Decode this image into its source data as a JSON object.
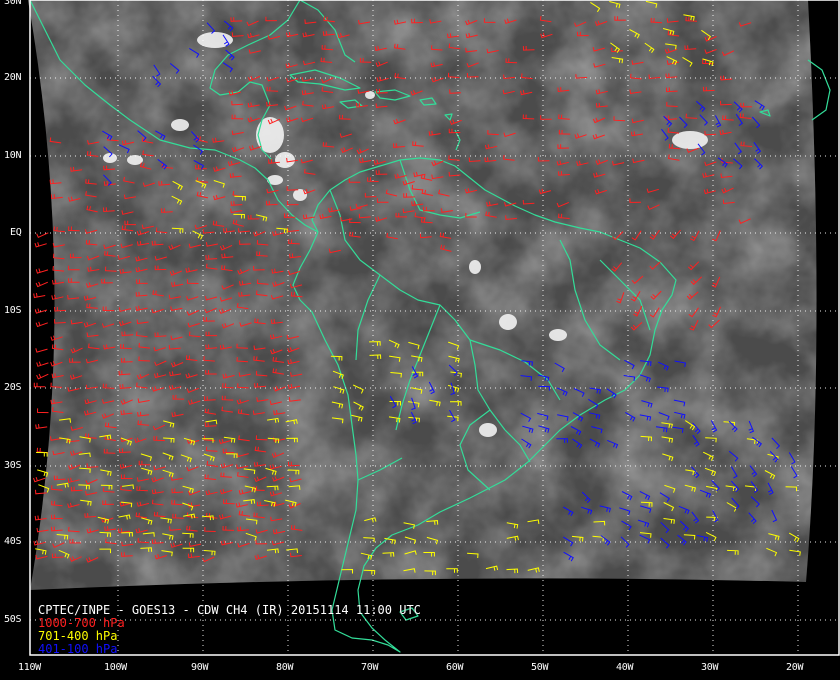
{
  "title": "CPTEC/INPE - GOES13 - CDW CH4 (IR) 20151114 11:00 UTC",
  "legend": [
    {
      "label": "1000-700 hPa",
      "color": "#ff2020"
    },
    {
      "label": "701-400 hPa",
      "color": "#ffff00"
    },
    {
      "label": "401-100 hPa",
      "color": "#1010ff"
    }
  ],
  "lat_labels": [
    "30N",
    "20N",
    "10N",
    "EQ",
    "10S",
    "20S",
    "30S",
    "40S",
    "50S"
  ],
  "lon_labels": [
    "110W",
    "100W",
    "90W",
    "80W",
    "70W",
    "60W",
    "50W",
    "40W",
    "30W",
    "20W"
  ],
  "colors": {
    "coast": "#33dd99",
    "grid": "#ffffff",
    "background": "#000000"
  }
}
